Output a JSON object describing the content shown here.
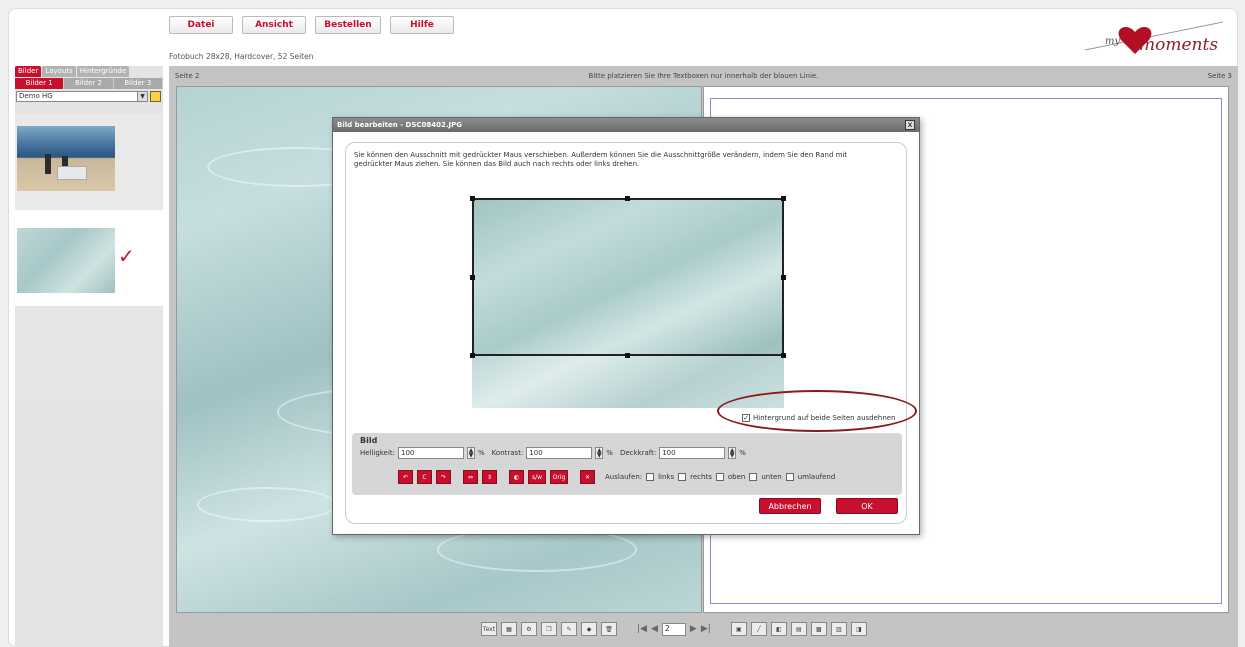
{
  "menu": {
    "items": [
      "Datei",
      "Ansicht",
      "Bestellen",
      "Hilfe"
    ]
  },
  "product_info": "Fotobuch 28x28, Hardcover, 52 Seiten",
  "logo": {
    "text": "my moments"
  },
  "sidebar": {
    "tabs": [
      "Bilder",
      "Layouts",
      "Hintergründe"
    ],
    "subtabs": [
      "Bilder 1",
      "Bilder 2",
      "Bilder 3"
    ],
    "folder_select": "Demo HG"
  },
  "workspace": {
    "left_page_label": "Seite 2",
    "hint": "Bitte platzieren Sie Ihre Textboxen nur innerhalb der blauen Linie.",
    "right_page_label": "Seite 3",
    "page_input": "2",
    "text_tool": "Text"
  },
  "dialog": {
    "title": "Bild bearbeiten - DSC08402.JPG",
    "close": "x",
    "instructions": "Sie können den Ausschnitt mit gedrückter Maus verschieben. Außerdem können Sie die Ausschnittgröße verändern, indem Sie den Rand mit gedrückter Maus ziehen. Sie können das Bild auch nach rechts oder links drehen.",
    "extend_bg_label": "Hintergrund auf beide Seiten ausdehnen",
    "extend_bg_checked": "✓",
    "panel_title": "Bild",
    "brightness_label": "Helligkeit:",
    "brightness_value": "100",
    "contrast_label": "Kontrast:",
    "contrast_value": "100",
    "opacity_label": "Deckkraft:",
    "opacity_value": "100",
    "percent": "%",
    "bleed_label": "Auslaufen:",
    "bleed_options": [
      "links",
      "rechts",
      "oben",
      "unten",
      "umlaufend"
    ],
    "cancel": "Abbrechen",
    "ok": "OK"
  },
  "colors": {
    "accent": "#c8102e",
    "guide": "#8a8ad0",
    "highlight_ring": "#8b1a1a"
  }
}
